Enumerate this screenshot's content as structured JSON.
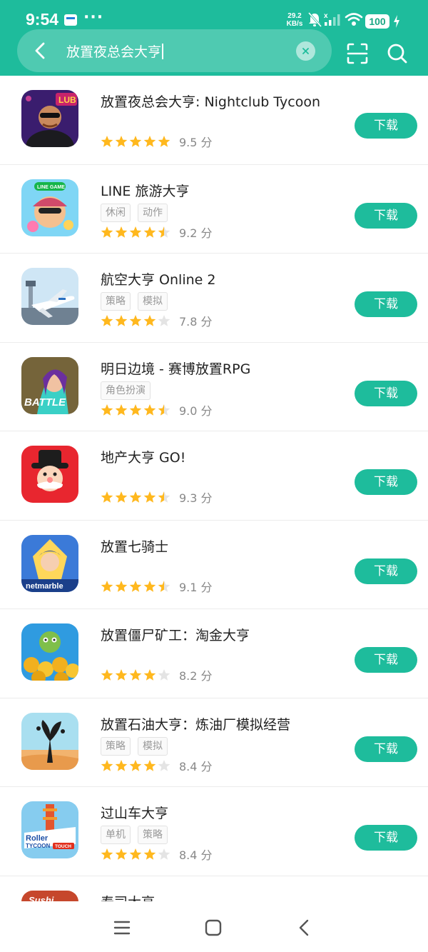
{
  "status_bar": {
    "time": "9:54",
    "dots": "···",
    "speed_value": "29.2",
    "speed_unit": "KB/s",
    "battery": "100"
  },
  "search": {
    "query": "放置夜总会大亨"
  },
  "download_label": "下载",
  "score_unit": "分",
  "colors": {
    "accent": "#1ebc9c",
    "star_on": "#ffb81e",
    "star_off": "#e4e4e4"
  },
  "apps": [
    {
      "name": "放置夜总会大亨: Nightclub Tycoon",
      "tags": [],
      "stars": 5,
      "score": "9.5",
      "icon": "nightclub-bouncer-icon"
    },
    {
      "name": "LINE 旅游大亨",
      "tags": [
        "休闲",
        "动作"
      ],
      "stars": 4.5,
      "score": "9.2",
      "icon": "line-game-character-icon"
    },
    {
      "name": "航空大亨 Online 2",
      "tags": [
        "策略",
        "模拟"
      ],
      "stars": 4,
      "score": "7.8",
      "icon": "airplane-icon"
    },
    {
      "name": "明日边境 - 赛博放置RPG",
      "tags": [
        "角色扮演"
      ],
      "stars": 4.5,
      "score": "9.0",
      "icon": "cyber-battle-girl-icon"
    },
    {
      "name": "地产大亨 GO!",
      "tags": [],
      "stars": 4.5,
      "score": "9.3",
      "icon": "monopoly-man-icon"
    },
    {
      "name": "放置七骑士",
      "tags": [],
      "stars": 4.5,
      "score": "9.1",
      "icon": "netmarble-knight-icon"
    },
    {
      "name": "放置僵尸矿工：淘金大亨",
      "tags": [],
      "stars": 4,
      "score": "8.2",
      "icon": "zombie-gold-coins-icon"
    },
    {
      "name": "放置石油大亨：炼油厂模拟经营",
      "tags": [
        "策略",
        "模拟"
      ],
      "stars": 4,
      "score": "8.4",
      "icon": "oil-gusher-icon"
    },
    {
      "name": "过山车大亨",
      "tags": [
        "单机",
        "策略"
      ],
      "stars": 4,
      "score": "8.4",
      "icon": "rollercoaster-tycoon-icon"
    },
    {
      "name": "寿司大亨",
      "tags": [],
      "stars": 0,
      "score": "",
      "icon": "sushi-icon"
    }
  ]
}
